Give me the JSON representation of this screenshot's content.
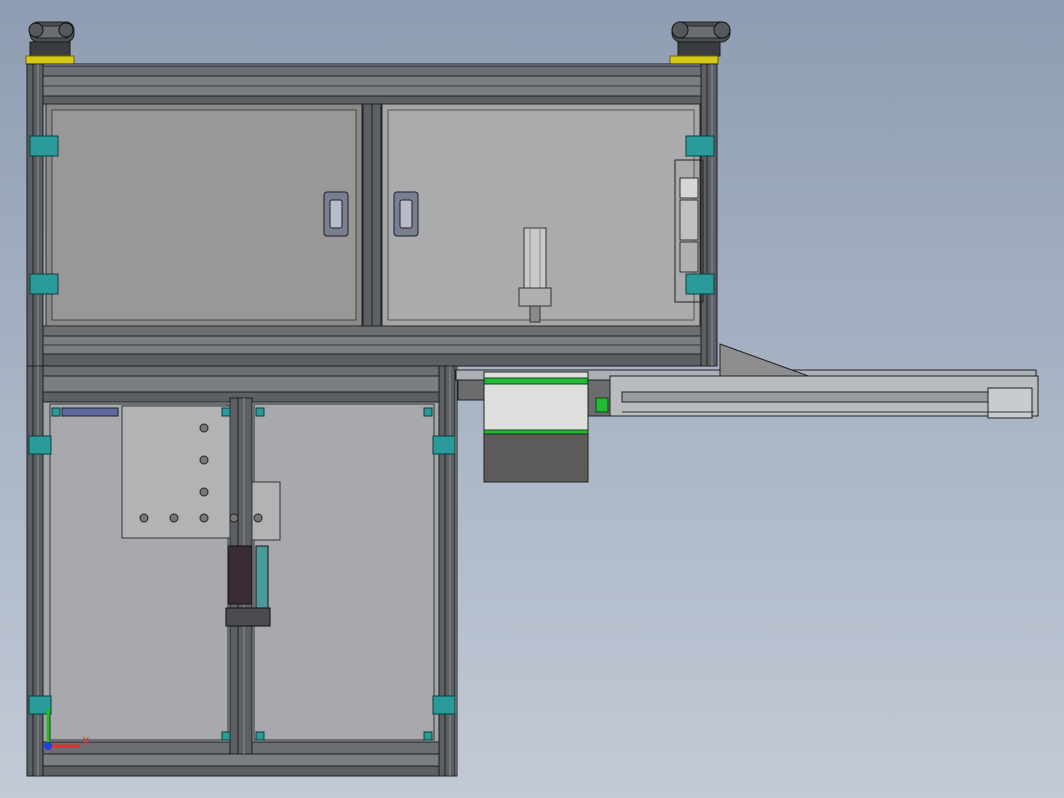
{
  "model_view": {
    "background_top": "#8e9db3",
    "background_bottom": "#c3cad6",
    "frame_color": "#5c5f63",
    "glass_color": "#9a9a98",
    "bracket_color": "#2a9a9a",
    "foot_pad_color": "#d8c81a",
    "belt_color": "#22bb33"
  },
  "triad": {
    "x_label": "X",
    "x_color": "#e03030",
    "y_color": "#20c020",
    "z_color": "#2040e0"
  }
}
